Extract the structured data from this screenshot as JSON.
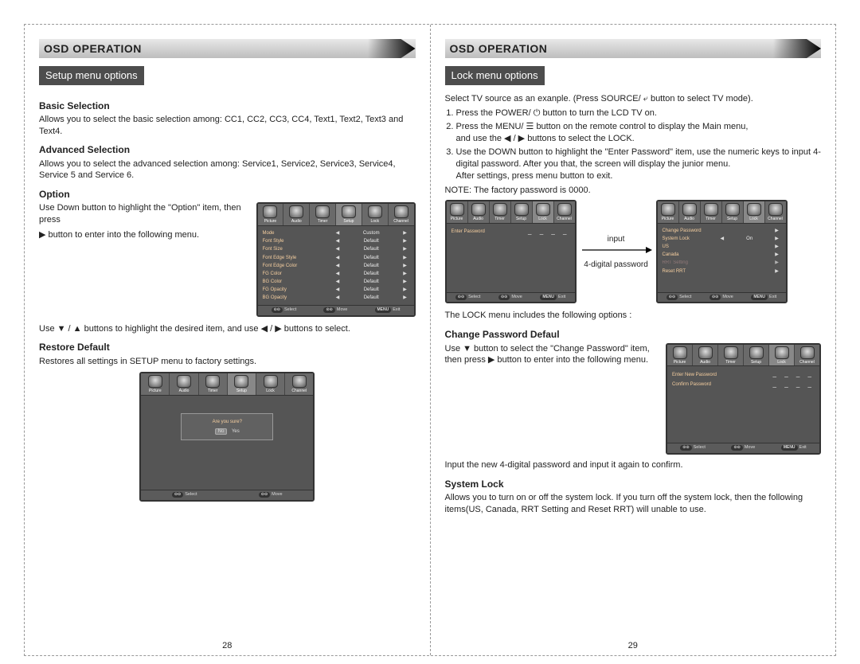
{
  "left_page": {
    "header": "OSD OPERATION",
    "section": "Setup menu options",
    "basic_heading": "Basic Selection",
    "basic_text": "Allows you to select the basic selection among: CC1, CC2, CC3, CC4, Text1, Text2, Text3 and Text4.",
    "advanced_heading": "Advanced Selection",
    "advanced_text": "Allows you to select the advanced selection among: Service1, Service2, Service3, Service4, Service 5 and Service 6.",
    "option_heading": "Option",
    "option_text1": "Use Down button to highlight the \"Option\" item, then press",
    "option_text2": "▶ button to enter into the following menu.",
    "option_footer": "Use ▼ / ▲ buttons to highlight the desired item, and use ◀ / ▶ buttons to select.",
    "restore_heading": "Restore Default",
    "restore_text": "Restores all settings in SETUP menu to factory settings.",
    "pagenum": "28",
    "osd_tabs": [
      "Picture",
      "Audio",
      "Timer",
      "Setup",
      "Lock",
      "Channel"
    ],
    "osd_option_rows": [
      {
        "name": "Mode",
        "val": "Custom"
      },
      {
        "name": "Font Style",
        "val": "Default"
      },
      {
        "name": "Font Size",
        "val": "Default"
      },
      {
        "name": "Font Edge Style",
        "val": "Default"
      },
      {
        "name": "Font Edge Color",
        "val": "Default"
      },
      {
        "name": "FG Color",
        "val": "Default"
      },
      {
        "name": "BG Color",
        "val": "Default"
      },
      {
        "name": "FG Opacity",
        "val": "Default"
      },
      {
        "name": "BG Opacity",
        "val": "Default"
      }
    ],
    "osd_foot": {
      "select": "Select",
      "move": "Move",
      "exit": "Exit"
    },
    "dialog_title": "Are you sure?",
    "dialog_no": "No",
    "dialog_yes": "Yes"
  },
  "right_page": {
    "header": "OSD OPERATION",
    "section": "Lock menu options",
    "intro": "Select TV source as an exanple. (Press SOURCE/ ⤶ button to select TV mode).",
    "step1": "Press the POWER/ ⏻ button to turn the LCD TV on.",
    "step2a": "Press the MENU/ ☰ button on the remote control to display the Main menu,",
    "step2b": "and use the ◀ / ▶ buttons to select the LOCK.",
    "step3a": "Use the DOWN button to highlight the \"Enter Password\" item, use the numeric keys to input 4-digital password. After you that, the screen will display the junior menu.",
    "step3b": "After settings, press menu button to exit.",
    "note": "NOTE: The factory password is 0000.",
    "arrow_label1": "input",
    "arrow_label2": "4-digital password",
    "enter_pw_label": "Enter Password",
    "lock_rows": [
      {
        "name": "Change Password",
        "val": "",
        "right": true
      },
      {
        "name": "System Lock",
        "val": "On",
        "arrows": true
      },
      {
        "name": "US",
        "val": "",
        "right": true
      },
      {
        "name": "Canada",
        "val": "",
        "right": true
      },
      {
        "name": "RRT Setting",
        "val": "",
        "right": true,
        "dim": true
      },
      {
        "name": "Reset RRT",
        "val": "",
        "right": true
      }
    ],
    "lock_intro2": "The LOCK menu includes the following options :",
    "change_pw_heading": "Change Password Defaul",
    "change_pw_text": "Use ▼ button to select the \"Change Password\" item, then press ▶ button to enter into the following menu.",
    "change_pw_row1": "Enter New Password",
    "change_pw_row2": "Confirm Password",
    "change_pw_after": "Input the new 4-digital password and input it again to confirm.",
    "syslock_heading": "System Lock",
    "syslock_text": "Allows you to turn on or off the system lock. If you turn off the system lock, then the following items(US, Canada, RRT Setting and Reset RRT) will unable to use.",
    "pagenum": "29",
    "osd_foot": {
      "select": "Select",
      "move": "Move",
      "exit": "Exit"
    }
  }
}
